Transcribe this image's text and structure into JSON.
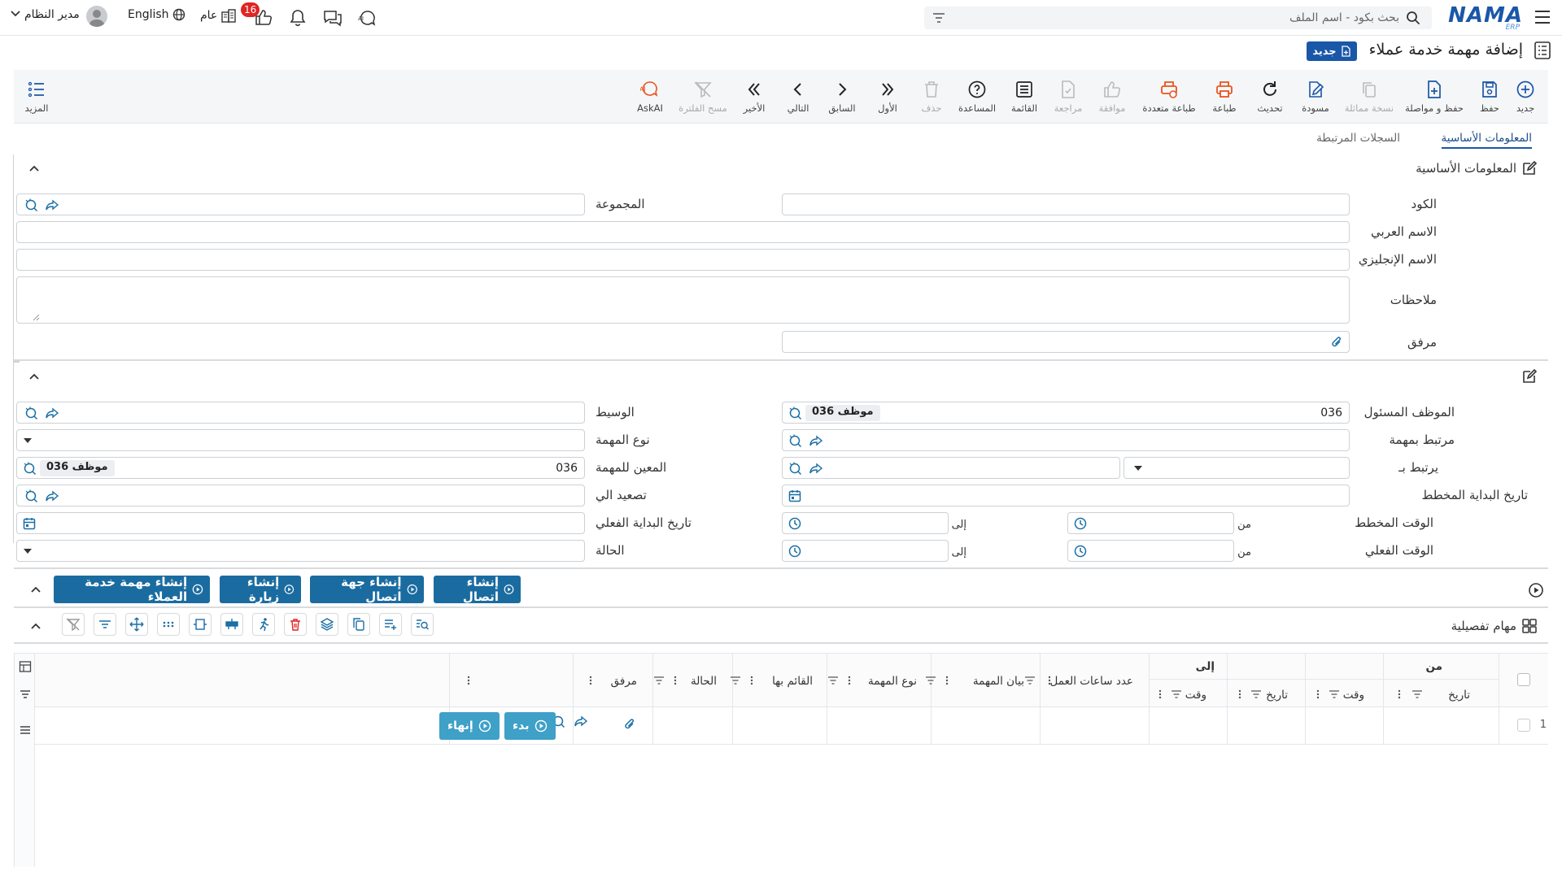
{
  "app": {
    "logo": "NAMA",
    "logo_sub": "ERP",
    "search_placeholder": "بحث بكود - اسم الملف",
    "user_name": "مدير النظام",
    "language": "English",
    "public_label": "عام",
    "notification_count": "16"
  },
  "page": {
    "title": "إضافة مهمة خدمة عملاء",
    "new_badge": "جديد"
  },
  "toolbar": {
    "new": "جديد",
    "save": "حفظ",
    "save_continue": "حفظ و مواصلة",
    "duplicate": "نسخة مماثلة",
    "draft": "مسودة",
    "refresh": "تحديث",
    "print": "طباعة",
    "multi_print": "طباعة متعددة",
    "approve": "موافقة",
    "review": "مراجعة",
    "list": "القائمة",
    "help": "المساعدة",
    "delete": "حذف",
    "first": "الأول",
    "previous": "السابق",
    "next": "التالي",
    "last": "الأخير",
    "clear_filter": "مسح الفلترة",
    "askai": "AskAI",
    "more": "المزيد"
  },
  "tabs": {
    "basic": "المعلومات الأساسية",
    "related": "السجلات المرتبطة"
  },
  "section1": {
    "title": "المعلومات الأساسية",
    "code": "الكود",
    "group": "المجموعة",
    "arabic_name": "الاسم العربي",
    "english_name": "الاسم الإنجليزي",
    "notes": "ملاحظات",
    "attachment": "مرفق"
  },
  "section2": {
    "responsible_employee": "الموظف المسئول",
    "responsible_code": "036",
    "responsible_chip": "موظف 036",
    "broker": "الوسيط",
    "linked_task": "مرتبط بمهمة",
    "task_type": "نوع المهمة",
    "linked_to": "يرتبط بـ",
    "task_assignee": "المعين للمهمة",
    "assignee_code": "036",
    "assignee_chip": "موظف 036",
    "planned_start_date": "تاريخ البداية المخطط",
    "escalate_to": "تصعيد الي",
    "planned_time": "الوقت المخطط",
    "actual_start_date": "تاريخ البداية الفعلي",
    "actual_time": "الوقت الفعلي",
    "status": "الحالة",
    "from": "من",
    "to": "إلى"
  },
  "actions": {
    "create_contact": "إنشاء اتصال",
    "create_contact_party": "إنشاء جهة اتصال",
    "create_visit": "إنشاء زيارة",
    "create_cs_task": "إنشاء مهمة خدمة العملاء"
  },
  "detail": {
    "title": "مهام تفصيلية",
    "from": "من",
    "to": "إلى",
    "date": "تاريخ",
    "time": "وقت",
    "work_hours": "عدد ساعات العمل",
    "task_statement": "بيان المهمة",
    "task_type": "نوع المهمة",
    "performer": "القائم بها",
    "status": "الحالة",
    "attachment": "مرفق",
    "row_number": "1",
    "start_btn": "بدء",
    "finish_btn": "إنهاء"
  }
}
